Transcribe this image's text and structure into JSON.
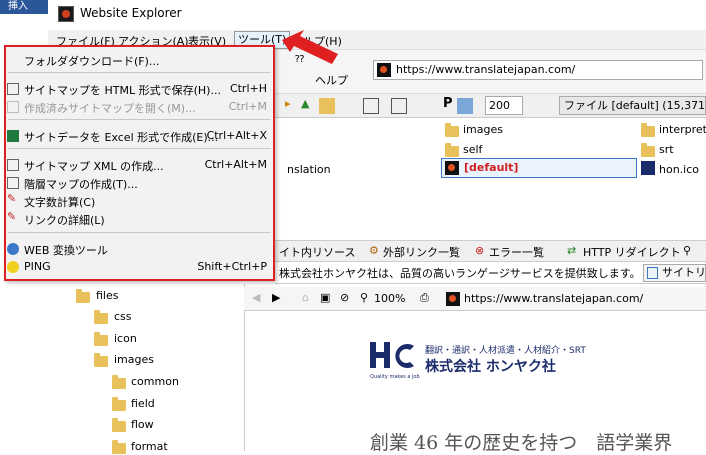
{
  "window": {
    "insert_label": "挿入",
    "title": "Website Explorer"
  },
  "menubar": {
    "file": "ファイル(F)",
    "action": "アクション(A)",
    "view": "表示(V)",
    "tools": "ツール(T)",
    "help": "ヘルプ(H)"
  },
  "toolbar": {
    "help_label": "ヘルプ",
    "url": "https://www.translatejapan.com/",
    "zoom_value": "200",
    "file_info": "ファイル [default] (15,371バイ"
  },
  "files": {
    "col2": [
      "images",
      "self"
    ],
    "col3": [
      "interpret",
      "srt"
    ],
    "translation_partial": "nslation",
    "default_item": "[default]",
    "hon_ico": "hon.ico"
  },
  "tabs": {
    "internal": "イト内リソース",
    "external": "外部リンク一覧",
    "errors": "エラー一覧",
    "redirect": "HTTP リダイレクト"
  },
  "info_bar": {
    "text": "株式会社ホンヤク社は、品質の高いランゲージサービスを提供致します。",
    "site_label": "サイトリ"
  },
  "tree": {
    "items": [
      {
        "label": "files"
      },
      {
        "label": "css"
      },
      {
        "label": "icon"
      },
      {
        "label": "images"
      },
      {
        "label": "common"
      },
      {
        "label": "field"
      },
      {
        "label": "flow"
      },
      {
        "label": "format"
      }
    ]
  },
  "browser": {
    "zoom": "100%",
    "url": "https://www.translatejapan.com/",
    "company_tagline_top": "翻訳・通訳・人材派遣・人材紹介・SRT",
    "company_name": "株式会社 ホンヤク社",
    "quality_text": "Quality makes a job",
    "headline": "創業 46 年の歴史を持つ　語学業界"
  },
  "dropdown": {
    "items": [
      {
        "label": "フォルダダウンロード(F)...",
        "shortcut": ""
      },
      {
        "label": "サイトマップを HTML 形式で保存(H)...",
        "shortcut": "Ctrl+H"
      },
      {
        "label": "作成済みサイトマップを開く(M)...",
        "shortcut": "Ctrl+M"
      },
      {
        "label": "サイトデータを Excel 形式で作成(E)...",
        "shortcut": "Ctrl+Alt+X"
      },
      {
        "label": "サイトマップ XML の作成...",
        "shortcut": "Ctrl+Alt+M"
      },
      {
        "label": "階層マップの作成(T)...",
        "shortcut": ""
      },
      {
        "label": "文字数計算(C)",
        "shortcut": ""
      },
      {
        "label": "リンクの詳細(L)",
        "shortcut": ""
      },
      {
        "label": "WEB 変換ツール",
        "shortcut": ""
      },
      {
        "label": "PING",
        "shortcut": "Shift+Ctrl+P"
      }
    ]
  },
  "colors": {
    "highlight_border": "#e02020",
    "menu_bg": "#f2f2f2",
    "accent_blue": "#1b2c6b"
  }
}
